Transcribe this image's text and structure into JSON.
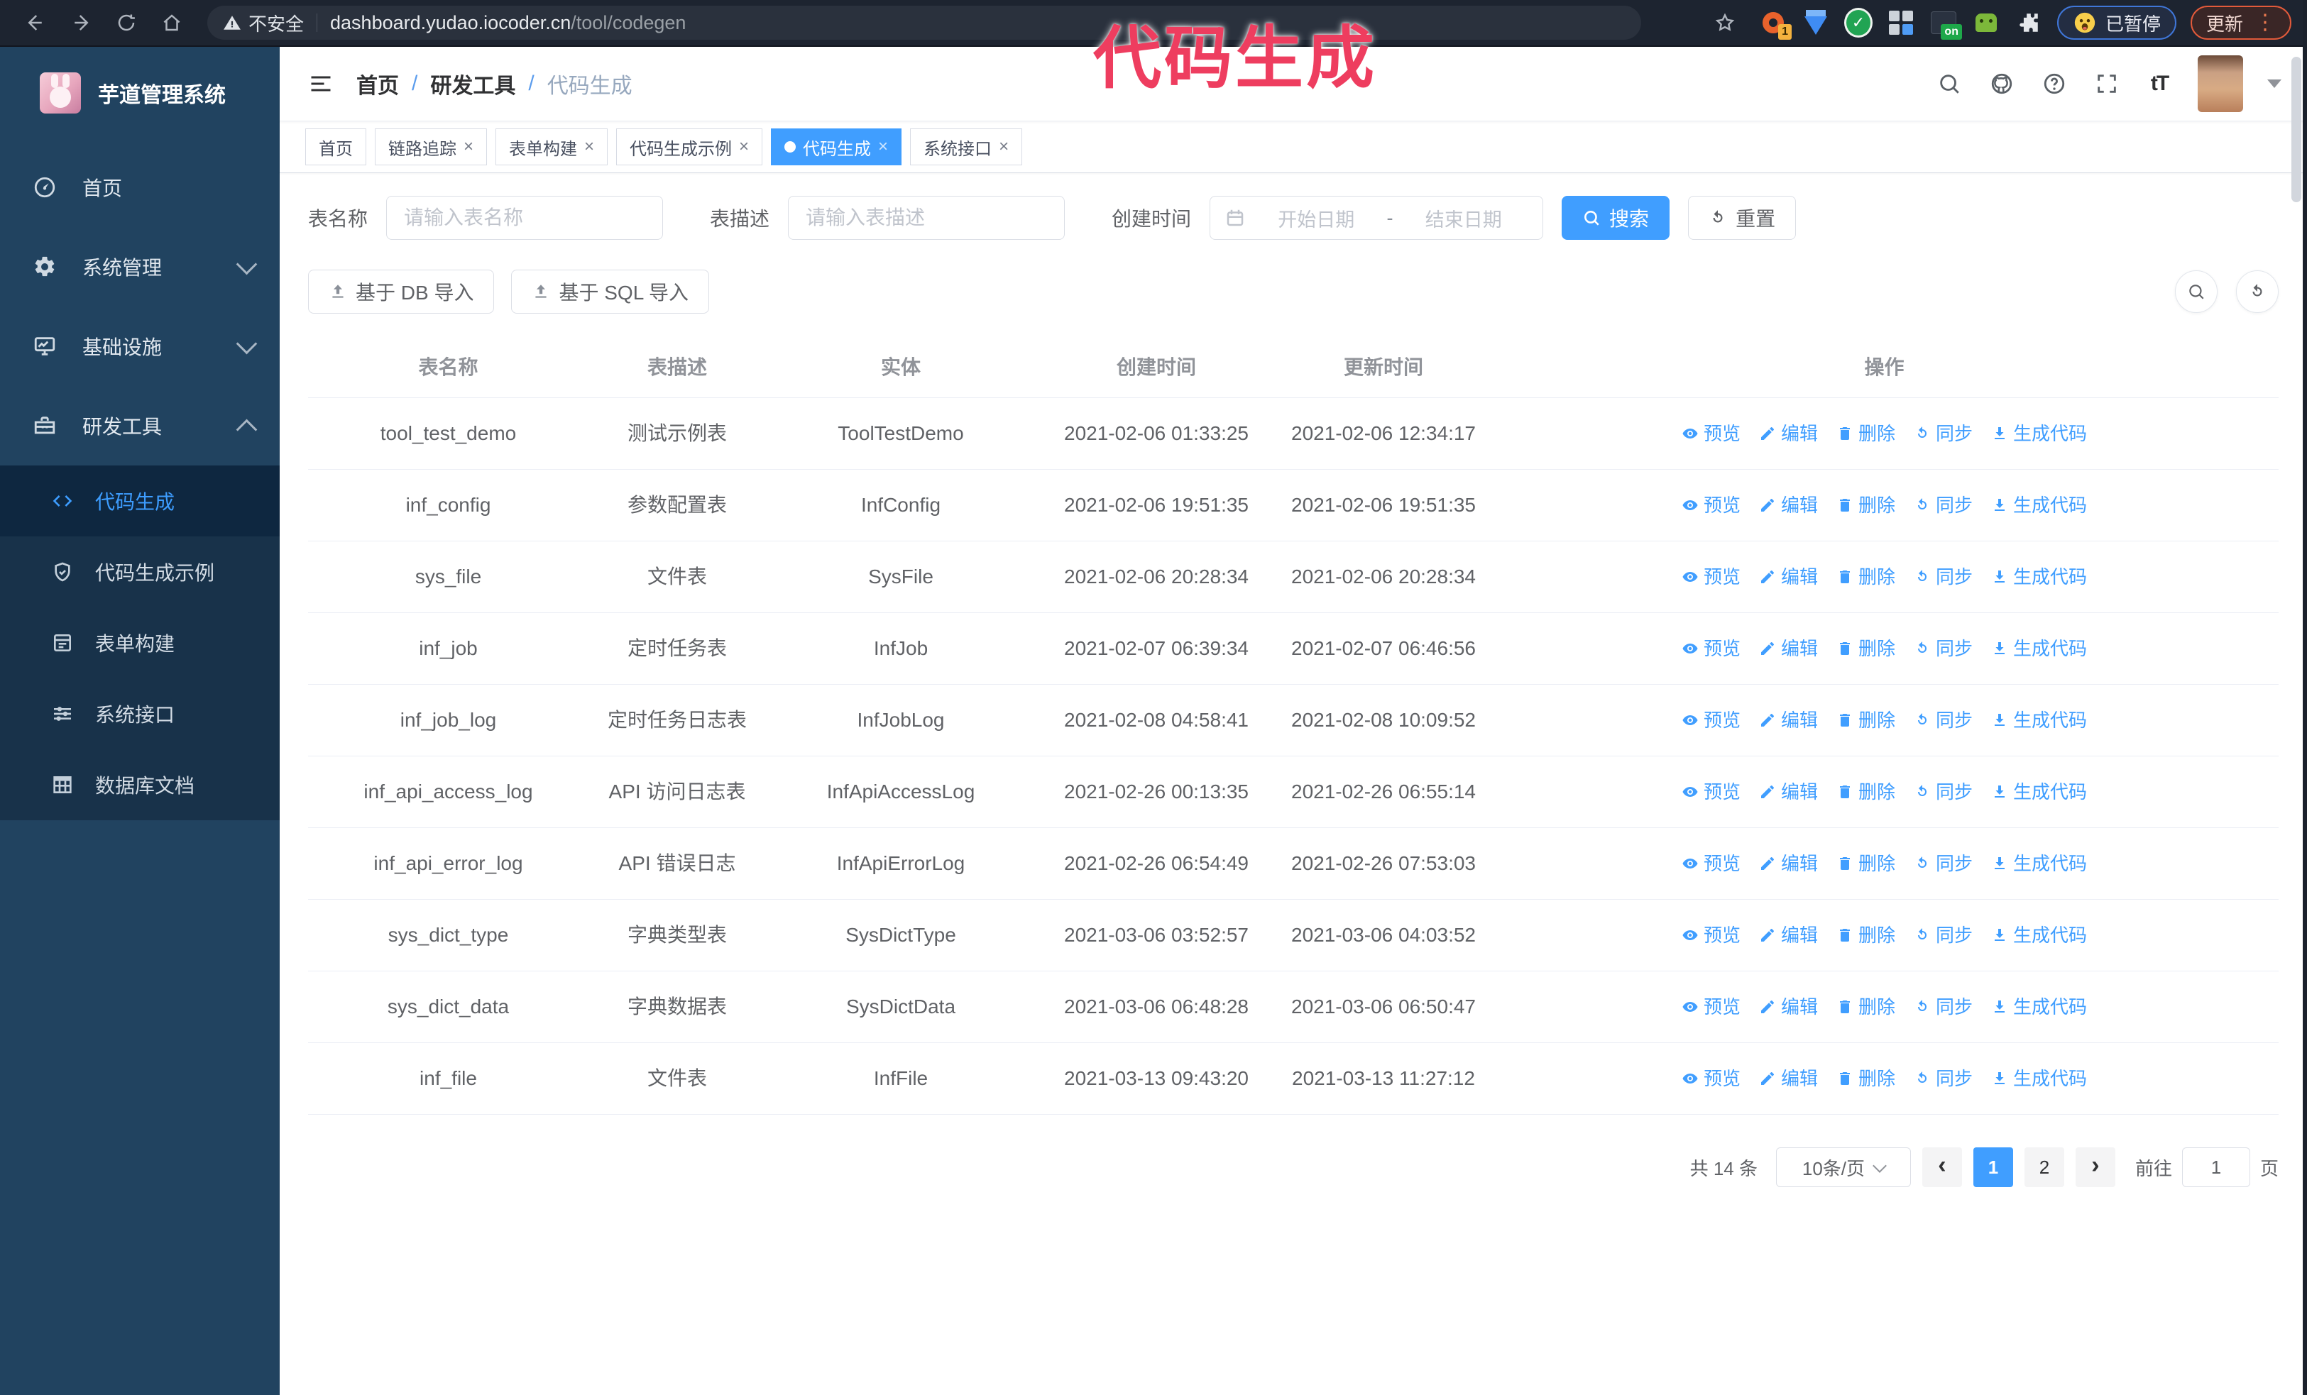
{
  "browser": {
    "security_warning": "不安全",
    "url_domain": "dashboard.yudao.iocoder.cn",
    "url_path": "/tool/codegen",
    "ext_badge_1": "1",
    "ext_badge_on": "on",
    "paused_badge": "已暂停",
    "update_button": "更新"
  },
  "overlay": {
    "title": "代码生成",
    "color": "#ee3d5f"
  },
  "sidebar": {
    "app_title": "芋道管理系统",
    "menu": [
      {
        "label": "首页",
        "icon": "dashboard-icon",
        "chevron": "none"
      },
      {
        "label": "系统管理",
        "icon": "gear-icon",
        "chevron": "down"
      },
      {
        "label": "基础设施",
        "icon": "monitor-icon",
        "chevron": "down"
      },
      {
        "label": "研发工具",
        "icon": "toolbox-icon",
        "chevron": "up"
      }
    ],
    "submenu": [
      {
        "label": "代码生成",
        "icon": "code-icon",
        "active": true
      },
      {
        "label": "代码生成示例",
        "icon": "shield-check-icon",
        "active": false
      },
      {
        "label": "表单构建",
        "icon": "form-icon",
        "active": false
      },
      {
        "label": "系统接口",
        "icon": "sliders-icon",
        "active": false
      },
      {
        "label": "数据库文档",
        "icon": "db-table-icon",
        "active": false
      }
    ]
  },
  "header": {
    "breadcrumb": [
      "首页",
      "研发工具",
      "代码生成"
    ],
    "breadcrumb_separator": "/"
  },
  "tabs": [
    {
      "label": "首页",
      "closable": false,
      "active": false
    },
    {
      "label": "链路追踪",
      "closable": true,
      "active": false
    },
    {
      "label": "表单构建",
      "closable": true,
      "active": false
    },
    {
      "label": "代码生成示例",
      "closable": true,
      "active": false
    },
    {
      "label": "代码生成",
      "closable": true,
      "active": true
    },
    {
      "label": "系统接口",
      "closable": true,
      "active": false
    }
  ],
  "filters": {
    "table_name_label": "表名称",
    "table_name_placeholder": "请输入表名称",
    "table_desc_label": "表描述",
    "table_desc_placeholder": "请输入表描述",
    "create_time_label": "创建时间",
    "date_start_placeholder": "开始日期",
    "date_separator": "-",
    "date_end_placeholder": "结束日期",
    "search_label": "搜索",
    "reset_label": "重置"
  },
  "toolbar": {
    "import_db_label": "基于 DB 导入",
    "import_sql_label": "基于 SQL 导入"
  },
  "table": {
    "columns": [
      "表名称",
      "表描述",
      "实体",
      "创建时间",
      "更新时间",
      "操作"
    ],
    "actions": [
      "预览",
      "编辑",
      "删除",
      "同步",
      "生成代码"
    ],
    "rows": [
      {
        "name": "tool_test_demo",
        "desc": "测试示例表",
        "entity": "ToolTestDemo",
        "created": "2021-02-06 01:33:25",
        "updated": "2021-02-06 12:34:17"
      },
      {
        "name": "inf_config",
        "desc": "参数配置表",
        "entity": "InfConfig",
        "created": "2021-02-06 19:51:35",
        "updated": "2021-02-06 19:51:35"
      },
      {
        "name": "sys_file",
        "desc": "文件表",
        "entity": "SysFile",
        "created": "2021-02-06 20:28:34",
        "updated": "2021-02-06 20:28:34"
      },
      {
        "name": "inf_job",
        "desc": "定时任务表",
        "entity": "InfJob",
        "created": "2021-02-07 06:39:34",
        "updated": "2021-02-07 06:46:56"
      },
      {
        "name": "inf_job_log",
        "desc": "定时任务日志表",
        "entity": "InfJobLog",
        "created": "2021-02-08 04:58:41",
        "updated": "2021-02-08 10:09:52"
      },
      {
        "name": "inf_api_access_log",
        "desc": "API 访问日志表",
        "entity": "InfApiAccessLog",
        "created": "2021-02-26 00:13:35",
        "updated": "2021-02-26 06:55:14"
      },
      {
        "name": "inf_api_error_log",
        "desc": "API 错误日志",
        "entity": "InfApiErrorLog",
        "created": "2021-02-26 06:54:49",
        "updated": "2021-02-26 07:53:03"
      },
      {
        "name": "sys_dict_type",
        "desc": "字典类型表",
        "entity": "SysDictType",
        "created": "2021-03-06 03:52:57",
        "updated": "2021-03-06 04:03:52"
      },
      {
        "name": "sys_dict_data",
        "desc": "字典数据表",
        "entity": "SysDictData",
        "created": "2021-03-06 06:48:28",
        "updated": "2021-03-06 06:50:47"
      },
      {
        "name": "inf_file",
        "desc": "文件表",
        "entity": "InfFile",
        "created": "2021-03-13 09:43:20",
        "updated": "2021-03-13 11:27:12"
      }
    ]
  },
  "pagination": {
    "total_text": "共 14 条",
    "page_size": "10条/页",
    "pages": [
      "1",
      "2"
    ],
    "current_page": "1",
    "goto_label": "前往",
    "goto_value": "1",
    "goto_suffix": "页"
  },
  "colors": {
    "accent": "#409eff",
    "sidebar": "#214360",
    "chrome": "#1d2430"
  }
}
